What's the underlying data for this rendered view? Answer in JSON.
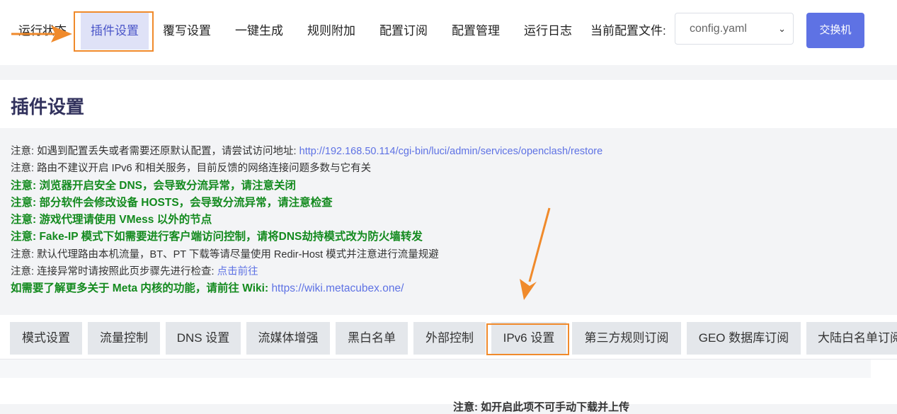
{
  "nav": {
    "items": [
      "运行状态",
      "插件设置",
      "覆写设置",
      "一键生成",
      "规则附加",
      "配置订阅",
      "配置管理",
      "运行日志"
    ],
    "config_label": "当前配置文件:",
    "config_value": "config.yaml",
    "switch_label": "交换机"
  },
  "page_title": "插件设置",
  "notes": [
    {
      "prefix": "注意: ",
      "text": "如遇到配置丢失或者需要还原默认配置，请尝试访问地址: ",
      "link": "http://192.168.50.114/cgi-bin/luci/admin/services/openclash/restore"
    },
    {
      "prefix": "注意: ",
      "text": "路由不建议开启 IPv6 和相关服务，目前反馈的网络连接问题多数与它有关"
    },
    {
      "prefix": "注意: ",
      "text": "浏览器开启安全 DNS，会导致分流异常，请注意关闭"
    },
    {
      "prefix": "注意: ",
      "text": "部分软件会修改设备 HOSTS，会导致分流异常，请注意检查"
    },
    {
      "prefix": "注意: ",
      "text": "游戏代理请使用 VMess 以外的节点"
    },
    {
      "prefix": "注意: ",
      "text": "Fake-IP 模式下如需要进行客户端访问控制，请将DNS劫持模式改为防火墙转发"
    },
    {
      "prefix": "注意: ",
      "text": "默认代理路由本机流量，BT、PT 下载等请尽量使用 Redir-Host 模式并注意进行流量规避"
    },
    {
      "prefix": "注意: ",
      "text": "连接异常时请按照此页步骤先进行检查: ",
      "link": "点击前往"
    },
    {
      "text": "如需要了解更多关于 Meta 内核的功能，请前往 Wiki: ",
      "link": "https://wiki.metacubex.one/"
    }
  ],
  "tabs": [
    "模式设置",
    "流量控制",
    "DNS 设置",
    "流媒体增强",
    "黑白名单",
    "外部控制",
    "IPv6 设置",
    "第三方规则订阅",
    "GEO 数据库订阅",
    "大陆白名单订阅"
  ],
  "bottom_text": "注意: 如开启此项不可手动下载并上传",
  "colors": {
    "accent": "#5e72e4",
    "annotation": "#f08a2b",
    "note_green": "#138a1e"
  }
}
